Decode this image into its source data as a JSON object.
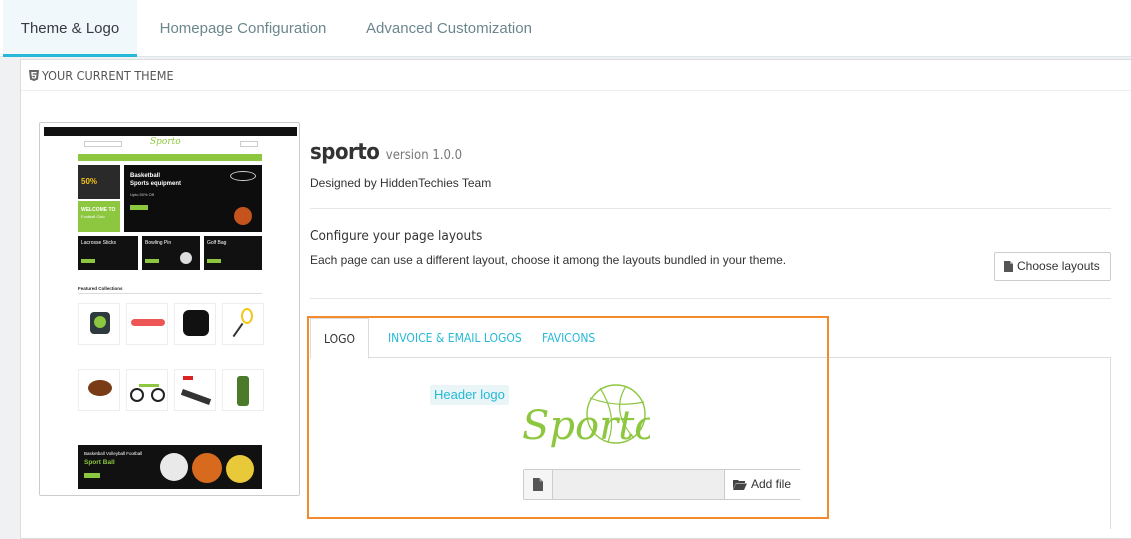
{
  "tabs": [
    {
      "label": "Theme & Logo",
      "active": true
    },
    {
      "label": "Homepage Configuration",
      "active": false
    },
    {
      "label": "Advanced Customization",
      "active": false
    }
  ],
  "panel": {
    "heading": "YOUR CURRENT THEME",
    "heading_icon": "html5-icon"
  },
  "theme": {
    "name": "sporto",
    "version": "version 1.0.0",
    "designer": "Designed by HiddenTechies Team"
  },
  "layouts": {
    "title": "Configure your page layouts",
    "description": "Each page can use a different layout, choose it among the layouts bundled in your theme.",
    "button_label": "Choose layouts",
    "button_icon": "file-icon"
  },
  "logo_tabs": [
    {
      "label": "LOGO",
      "active": true
    },
    {
      "label": "INVOICE & EMAIL LOGOS",
      "active": false
    },
    {
      "label": "FAVICONS",
      "active": false
    }
  ],
  "logo": {
    "label": "Header logo",
    "image_text": "Sporto",
    "add_file_label": "Add file",
    "add_file_icon": "folder-open-icon",
    "file_icon": "file-icon"
  },
  "preview": {
    "banner_title": "Basketball Sports equipment",
    "banner_line1": "Basketball",
    "banner_line2": "Sports equipment",
    "banner_sub": "Upto 50% Off",
    "welcome_line1": "WELCOME TO",
    "welcome_line2": "Football Club",
    "promo_50": "50%",
    "tiles": [
      "Lacrosse Sticks",
      "Bowling Pin",
      "Golf Bag"
    ],
    "featured_title": "Featured Collections",
    "footer_banner_line1": "Basketball Volleyball Football",
    "footer_banner_line2": "Sport Ball",
    "brand": "Sporto"
  },
  "colors": {
    "accent": "#25b9d7",
    "highlight": "#f28a2e",
    "sporto_green": "#8dc63f"
  }
}
